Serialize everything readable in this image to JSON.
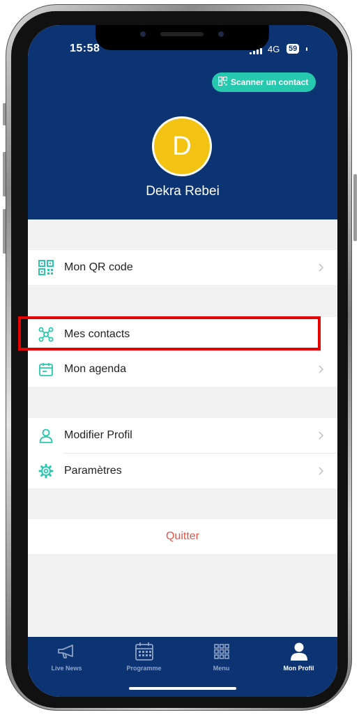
{
  "status_bar": {
    "time": "15:58",
    "network": "4G",
    "battery": "59"
  },
  "header": {
    "scan_button_label": "Scanner un contact",
    "avatar_initial": "D",
    "user_name": "Dekra Rebei"
  },
  "menu": {
    "section1": [
      {
        "label": "Mon QR code",
        "icon": "qr-code-icon"
      }
    ],
    "section2": [
      {
        "label": "Mes contacts",
        "icon": "network-nodes-icon"
      },
      {
        "label": "Mon agenda",
        "icon": "calendar-icon"
      }
    ],
    "section3": [
      {
        "label": "Modifier Profil",
        "icon": "user-icon"
      },
      {
        "label": "Paramètres",
        "icon": "gear-icon"
      }
    ],
    "quit_label": "Quitter"
  },
  "tabbar": {
    "tabs": [
      {
        "label": "Live News",
        "icon": "megaphone-icon",
        "active": false
      },
      {
        "label": "Programme",
        "icon": "calendar-grid-icon",
        "active": false
      },
      {
        "label": "Menu",
        "icon": "grid-icon",
        "active": false
      },
      {
        "label": "Mon Profil",
        "icon": "person-icon",
        "active": true
      }
    ]
  },
  "colors": {
    "header_bg": "#0d3472",
    "accent_teal": "#27c9ae",
    "avatar_yellow": "#f2c313",
    "quit_red": "#e4544b",
    "highlight_red": "#e50000"
  }
}
